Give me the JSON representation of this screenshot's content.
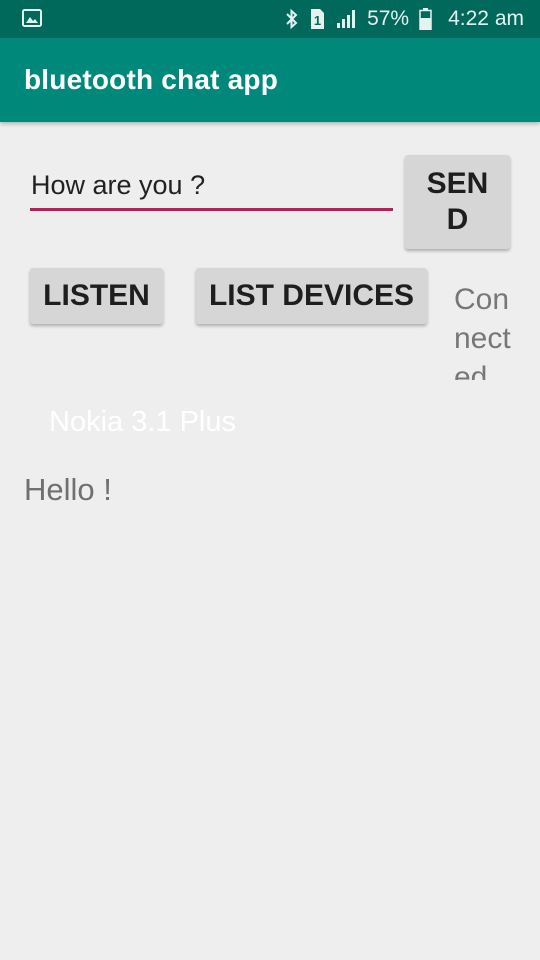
{
  "status_bar": {
    "battery": "57%",
    "time": "4:22 am",
    "sim_slot": "1",
    "icons": [
      "image-icon",
      "bluetooth-icon",
      "sim-icon",
      "signal-icon",
      "battery-icon"
    ]
  },
  "app_bar": {
    "title": "bluetooth chat app"
  },
  "message_input": {
    "value": "How are you ?"
  },
  "buttons": {
    "send": "SEND",
    "listen": "LISTEN",
    "list_devices": "LIST DEVICES"
  },
  "connection_status": "Connected",
  "devices": [
    "Nokia 3.1 Plus"
  ],
  "received_message": "Hello !",
  "colors": {
    "status_bar": "#00695c",
    "app_bar": "#00897b",
    "input_underline": "#c2185b",
    "background": "#eeeeee",
    "button": "#d6d6d6"
  }
}
